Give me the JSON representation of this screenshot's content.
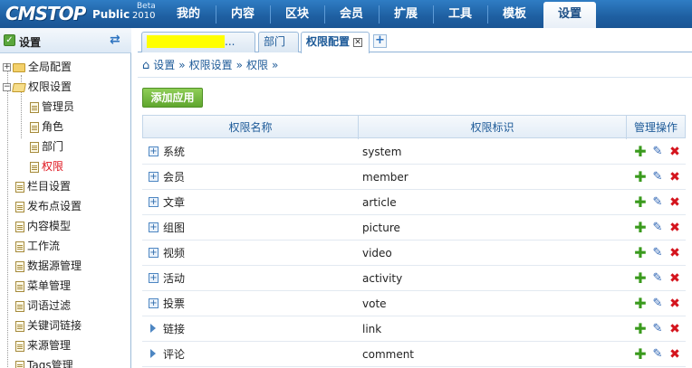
{
  "logo": {
    "main": "CMSTOP",
    "public": "Public",
    "beta": "Beta",
    "year": "2010"
  },
  "nav": [
    "我的",
    "内容",
    "区块",
    "会员",
    "扩展",
    "工具",
    "模板",
    "设置"
  ],
  "sidebar": {
    "title": "设置",
    "items": [
      {
        "label": "全局配置"
      },
      {
        "label": "权限设置"
      },
      {
        "label": "管理员"
      },
      {
        "label": "角色"
      },
      {
        "label": "部门"
      },
      {
        "label": "权限"
      },
      {
        "label": "栏目设置"
      },
      {
        "label": "发布点设置"
      },
      {
        "label": "内容模型"
      },
      {
        "label": "工作流"
      },
      {
        "label": "数据源管理"
      },
      {
        "label": "菜单管理"
      },
      {
        "label": "词语过滤"
      },
      {
        "label": "关键词链接"
      },
      {
        "label": "来源管理"
      },
      {
        "label": "Tags管理"
      }
    ]
  },
  "tabs": [
    {
      "label": "..."
    },
    {
      "label": "部门"
    },
    {
      "label": "权限配置"
    }
  ],
  "breadcrumb": [
    "设置",
    "权限设置",
    "权限"
  ],
  "add_button": "添加应用",
  "table": {
    "headers": [
      "权限名称",
      "权限标识",
      "管理操作"
    ],
    "rows": [
      {
        "name": "系统",
        "code": "system"
      },
      {
        "name": "会员",
        "code": "member"
      },
      {
        "name": "文章",
        "code": "article"
      },
      {
        "name": "组图",
        "code": "picture"
      },
      {
        "name": "视频",
        "code": "video"
      },
      {
        "name": "活动",
        "code": "activity"
      },
      {
        "name": "投票",
        "code": "vote"
      },
      {
        "name": "链接",
        "code": "link"
      },
      {
        "name": "评论",
        "code": "comment"
      }
    ]
  }
}
